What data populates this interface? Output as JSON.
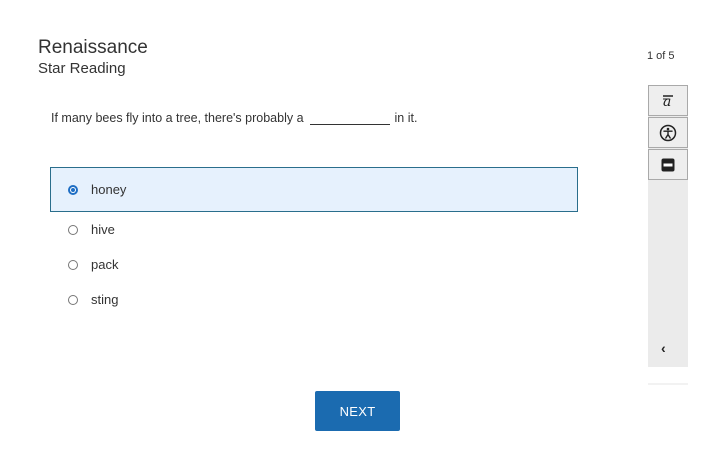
{
  "header": {
    "brand": "Renaissance",
    "product": "Star Reading"
  },
  "progress": {
    "label": "1 of 5"
  },
  "question": {
    "before_blank": "If many bees fly into a tree, there's probably a",
    "after_blank": "in it."
  },
  "options": [
    {
      "label": "honey",
      "selected": true
    },
    {
      "label": "hive",
      "selected": false
    },
    {
      "label": "pack",
      "selected": false
    },
    {
      "label": "sting",
      "selected": false
    }
  ],
  "toolbar": {
    "items": [
      {
        "icon": "text-style-icon"
      },
      {
        "icon": "accessibility-icon"
      },
      {
        "icon": "line-reader-icon"
      }
    ],
    "collapse_label": "‹"
  },
  "footer": {
    "next_label": "NEXT"
  },
  "colors": {
    "accent": "#1b6bb0",
    "selected_bg": "#e6f1fd",
    "selected_border": "#2a6e8c"
  }
}
